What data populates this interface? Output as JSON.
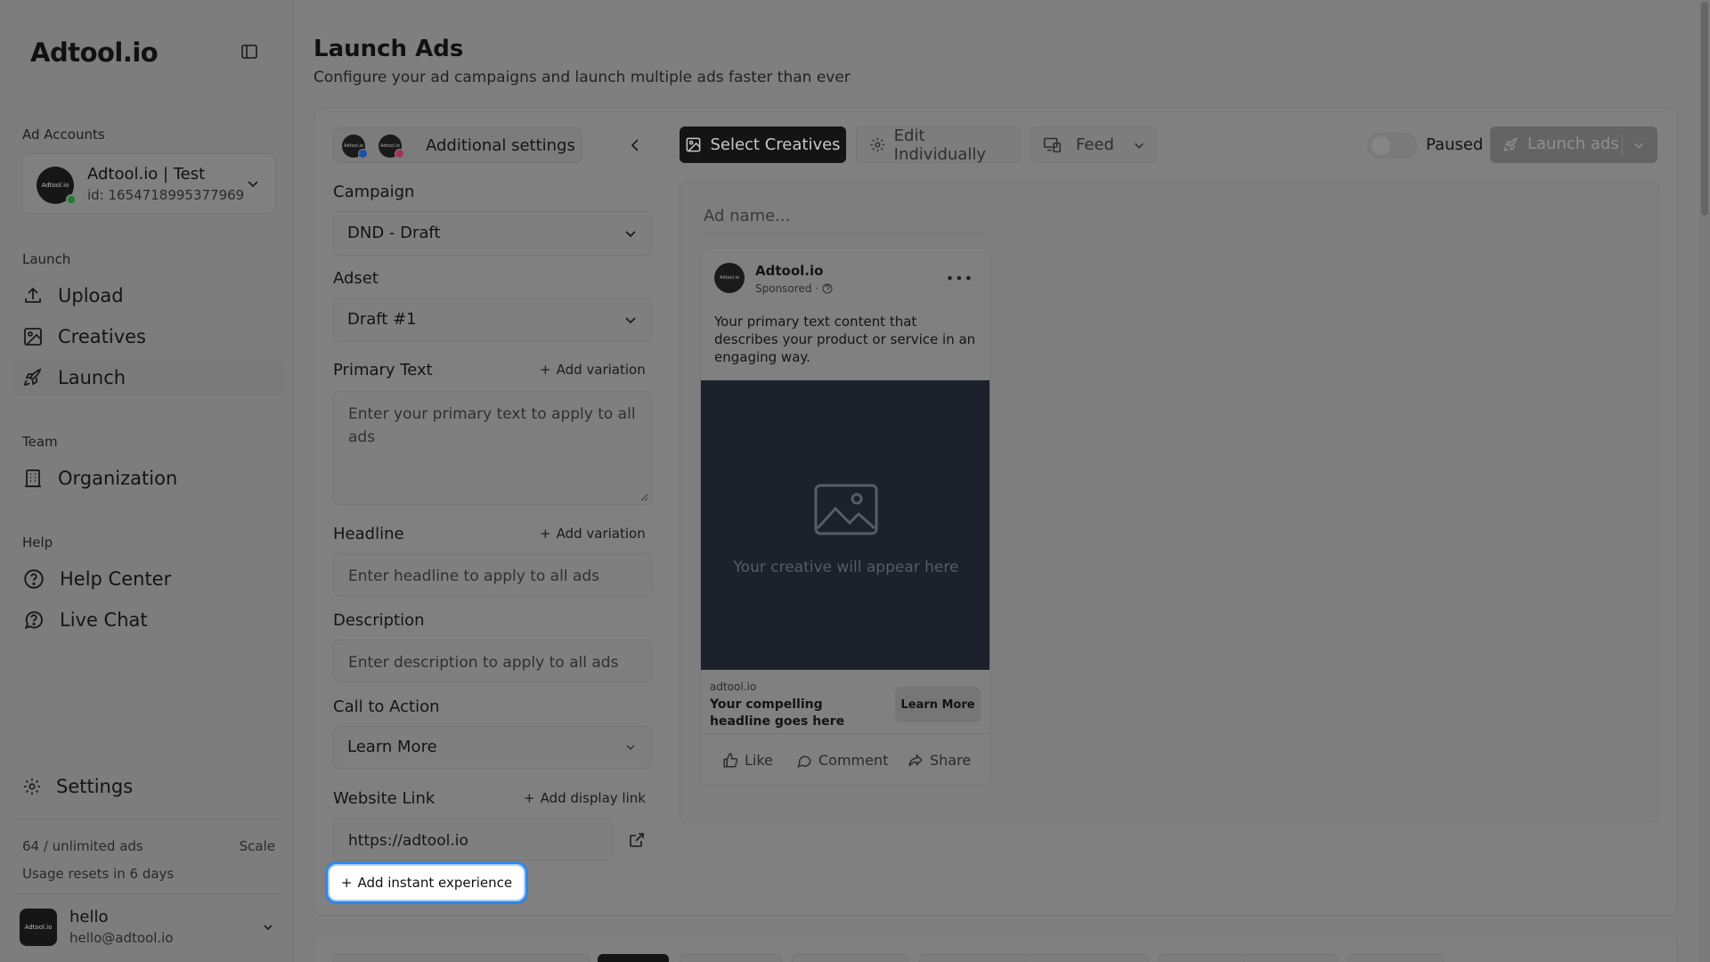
{
  "sidebar": {
    "logo": "Adtool.io",
    "ad_accounts_label": "Ad Accounts",
    "account": {
      "avatar_text": "Adtool.io",
      "name": "Adtool.io | Test",
      "id": "id: 1654718995377969"
    },
    "launch_label": "Launch",
    "launch_items": [
      {
        "label": "Upload",
        "icon": "upload-icon"
      },
      {
        "label": "Creatives",
        "icon": "image-icon"
      },
      {
        "label": "Launch",
        "icon": "rocket-icon",
        "active": true
      }
    ],
    "team_label": "Team",
    "team_items": [
      {
        "label": "Organization",
        "icon": "building-icon"
      }
    ],
    "help_label": "Help",
    "help_items": [
      {
        "label": "Help Center",
        "icon": "help-circle-icon"
      },
      {
        "label": "Live Chat",
        "icon": "chat-icon"
      }
    ],
    "settings_label": "Settings",
    "usage": "64 / unlimited ads",
    "scale": "Scale",
    "usage_reset": "Usage resets in 6 days",
    "user": {
      "avatar_text": "Adtool.io",
      "name": "hello",
      "email": "hello@adtool.io"
    }
  },
  "header": {
    "title": "Launch Ads",
    "subtitle": "Configure your ad campaigns and launch multiple ads faster than ever"
  },
  "settings": {
    "platform_icon_text": "Adtool.io",
    "tab_label": "Additional settings",
    "campaign_label": "Campaign",
    "campaign_value": "DND - Draft",
    "adset_label": "Adset",
    "adset_value": "Draft #1",
    "primary_text_label": "Primary Text",
    "add_variation": "Add variation",
    "primary_text_placeholder": "Enter your primary text to apply to all ads",
    "headline_label": "Headline",
    "headline_placeholder": "Enter headline to apply to all ads",
    "description_label": "Description",
    "description_placeholder": "Enter description to apply to all ads",
    "cta_label": "Call to Action",
    "cta_value": "Learn More",
    "website_label": "Website Link",
    "add_display_link": "Add display link",
    "website_value": "https://adtool.io",
    "add_instant_experience": "Add instant experience"
  },
  "toolbar": {
    "select_creatives": "Select Creatives",
    "edit_individually": "Edit Individually",
    "feed": "Feed",
    "paused": "Paused",
    "launch_ads": "Launch ads"
  },
  "preview": {
    "ad_name_placeholder": "Ad name...",
    "brand": "Adtool.io",
    "sponsored": "Sponsored ·",
    "primary_text": "Your primary text content that describes your product or service in an engaging way.",
    "media_placeholder": "Your creative will appear here",
    "domain": "adtool.io",
    "headline": "Your compelling headline goes here",
    "cta": "Learn More",
    "like": "Like",
    "comment": "Comment",
    "share": "Share"
  },
  "colors": {
    "primary_button": "#141414",
    "focus_ring": "#2f86e3",
    "status_online": "#1f7a35",
    "media_bg": "#1c212b"
  }
}
